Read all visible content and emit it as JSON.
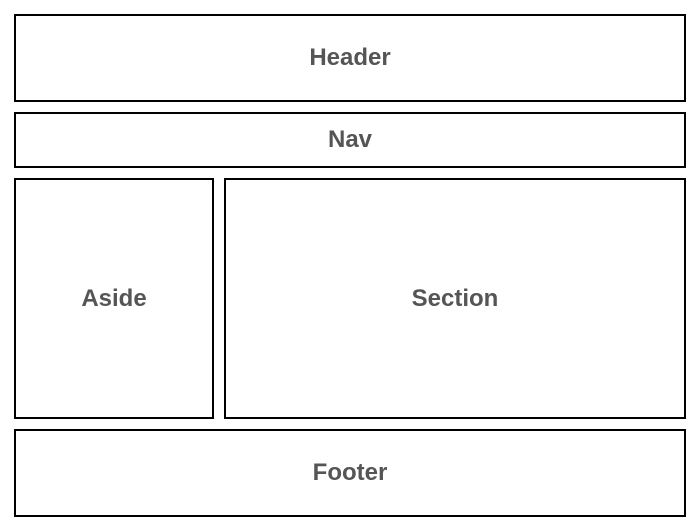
{
  "layout": {
    "header": "Header",
    "nav": "Nav",
    "aside": "Aside",
    "section": "Section",
    "footer": "Footer"
  }
}
